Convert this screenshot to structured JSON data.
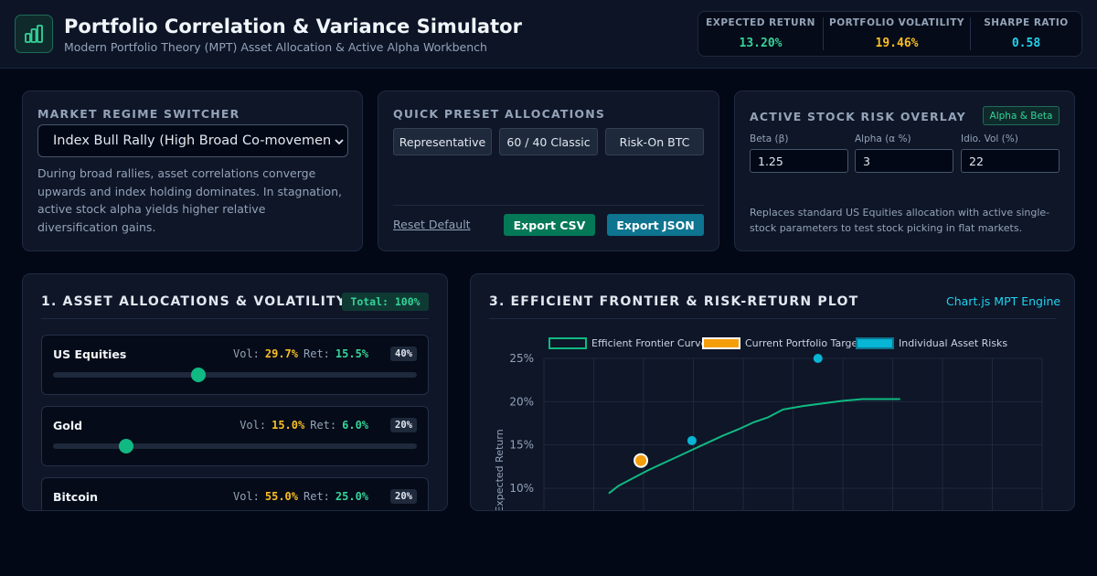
{
  "header": {
    "title": "Portfolio Correlation & Variance Simulator",
    "subtitle": "Modern Portfolio Theory (MPT) Asset Allocation & Active Alpha Workbench",
    "logo_icon": "bar-chart-icon"
  },
  "metrics": [
    {
      "label": "EXPECTED RETURN",
      "value": "13.20%",
      "color": "#34d399"
    },
    {
      "label": "PORTFOLIO VOLATILITY",
      "value": "19.46%",
      "color": "#fbbf24"
    },
    {
      "label": "SHARPE RATIO",
      "value": "0.58",
      "color": "#22d3ee"
    }
  ],
  "regime": {
    "title": "MARKET REGIME SWITCHER",
    "selected": "Index Bull Rally (High Broad Co-movemen",
    "description": "During broad rallies, asset correlations converge upwards and index holding dominates. In stagnation, active stock alpha yields higher relative diversification gains."
  },
  "presets": {
    "title": "QUICK PRESET ALLOCATIONS",
    "buttons": [
      "Representative",
      "60 / 40 Classic",
      "Risk-On BTC"
    ],
    "reset_label": "Reset Default",
    "export_csv_label": "Export CSV",
    "export_json_label": "Export JSON"
  },
  "overlay": {
    "title": "ACTIVE STOCK RISK OVERLAY",
    "badge": "Alpha & Beta",
    "fields": [
      {
        "label": "Beta (β)",
        "value": "1.25"
      },
      {
        "label": "Alpha (α %)",
        "value": "3"
      },
      {
        "label": "Idio. Vol (%)",
        "value": "22"
      }
    ],
    "description": "Replaces standard US Equities allocation with active single-stock parameters to test stock picking in flat markets."
  },
  "allocations": {
    "title": "1. ASSET ALLOCATIONS & VOLATILITY",
    "total_badge": "Total: 100%",
    "vol_key": "Vol:",
    "ret_key": "Ret:",
    "assets": [
      {
        "name": "US Equities",
        "vol": "29.7%",
        "ret": "15.5%",
        "weight": "40%",
        "weight_value": 40
      },
      {
        "name": "Gold",
        "vol": "15.0%",
        "ret": "6.0%",
        "weight": "20%",
        "weight_value": 20
      },
      {
        "name": "Bitcoin",
        "vol": "55.0%",
        "ret": "25.0%",
        "weight": "20%",
        "weight_value": 20
      }
    ]
  },
  "frontier": {
    "title": "3. EFFICIENT FRONTIER & RISK-RETURN PLOT",
    "engine_label": "Chart.js MPT Engine"
  },
  "chart_data": {
    "type": "scatter",
    "ylabel": "Expected Return",
    "y_ticks": [
      "25%",
      "20%",
      "15%",
      "10%"
    ],
    "ylim": [
      10,
      25
    ],
    "xlim": [
      0,
      100
    ],
    "grid": true,
    "legend_position": "top",
    "series": [
      {
        "name": "Efficient Frontier Curve",
        "style": "line",
        "color": "#10b981",
        "x": [
          13.0,
          15.0,
          17.0,
          19.0,
          21.0,
          24.0,
          27.0,
          30.0,
          33.0,
          36.0,
          39.0,
          42.0,
          45.0,
          48.0,
          52.0,
          56.0,
          60.0,
          64.0,
          68.0,
          71.5
        ],
        "y": [
          9.4,
          10.3,
          10.9,
          11.5,
          12.1,
          12.9,
          13.7,
          14.5,
          15.3,
          16.1,
          16.8,
          17.6,
          18.2,
          19.1,
          19.5,
          19.8,
          20.1,
          20.3,
          20.3,
          20.3
        ]
      },
      {
        "name": "Current Portfolio Target",
        "style": "point",
        "color": "#f59e0b",
        "x": [
          19.46
        ],
        "y": [
          13.2
        ]
      },
      {
        "name": "Individual Asset Risks",
        "style": "point",
        "color": "#06b6d4",
        "x": [
          29.7,
          55.0
        ],
        "y": [
          15.5,
          25.0
        ]
      }
    ]
  }
}
